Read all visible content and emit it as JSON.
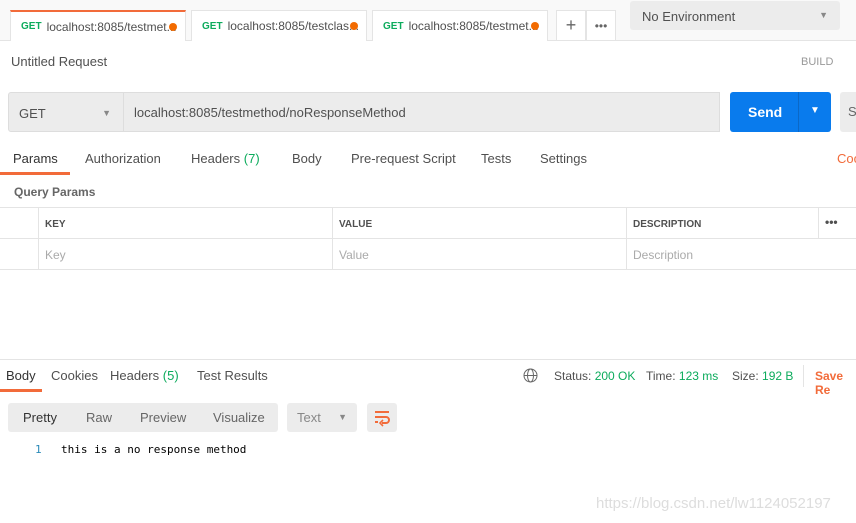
{
  "tabs": [
    {
      "method": "GET",
      "label": "localhost:8085/testmet...",
      "unsaved": true,
      "active": true
    },
    {
      "method": "GET",
      "label": "localhost:8085/testclas...",
      "unsaved": true,
      "active": false
    },
    {
      "method": "GET",
      "label": "localhost:8085/testmet...",
      "unsaved": true,
      "active": false
    }
  ],
  "environment": "No Environment",
  "request": {
    "title": "Untitled Request",
    "mode": "BUILD",
    "method": "GET",
    "url": "localhost:8085/testmethod/noResponseMethod",
    "send_label": "Send",
    "save_label": "S"
  },
  "request_tabs": [
    {
      "label": "Params",
      "active": true
    },
    {
      "label": "Authorization"
    },
    {
      "label": "Headers",
      "count": "(7)"
    },
    {
      "label": "Body"
    },
    {
      "label": "Pre-request Script"
    },
    {
      "label": "Tests"
    },
    {
      "label": "Settings"
    }
  ],
  "code_link": "Coo",
  "query_params": {
    "title": "Query Params",
    "columns": [
      "KEY",
      "VALUE",
      "DESCRIPTION"
    ],
    "placeholders": {
      "key": "Key",
      "value": "Value",
      "description": "Description"
    }
  },
  "response": {
    "tabs": [
      {
        "label": "Body",
        "active": true
      },
      {
        "label": "Cookies"
      },
      {
        "label": "Headers",
        "count": "(5)"
      },
      {
        "label": "Test Results"
      }
    ],
    "status_label": "Status:",
    "status": "200 OK",
    "time_label": "Time:",
    "time": "123 ms",
    "size_label": "Size:",
    "size": "192 B",
    "save_label": "Save Re",
    "formats": [
      "Pretty",
      "Raw",
      "Preview",
      "Visualize"
    ],
    "type": "Text",
    "lines": [
      {
        "num": "1",
        "text": "this is a no response method"
      }
    ]
  },
  "watermark": "https://blog.csdn.net/lw1124052197",
  "colors": {
    "accent": "#f26b3a",
    "primary": "#097bed",
    "success": "#0cab5c"
  }
}
